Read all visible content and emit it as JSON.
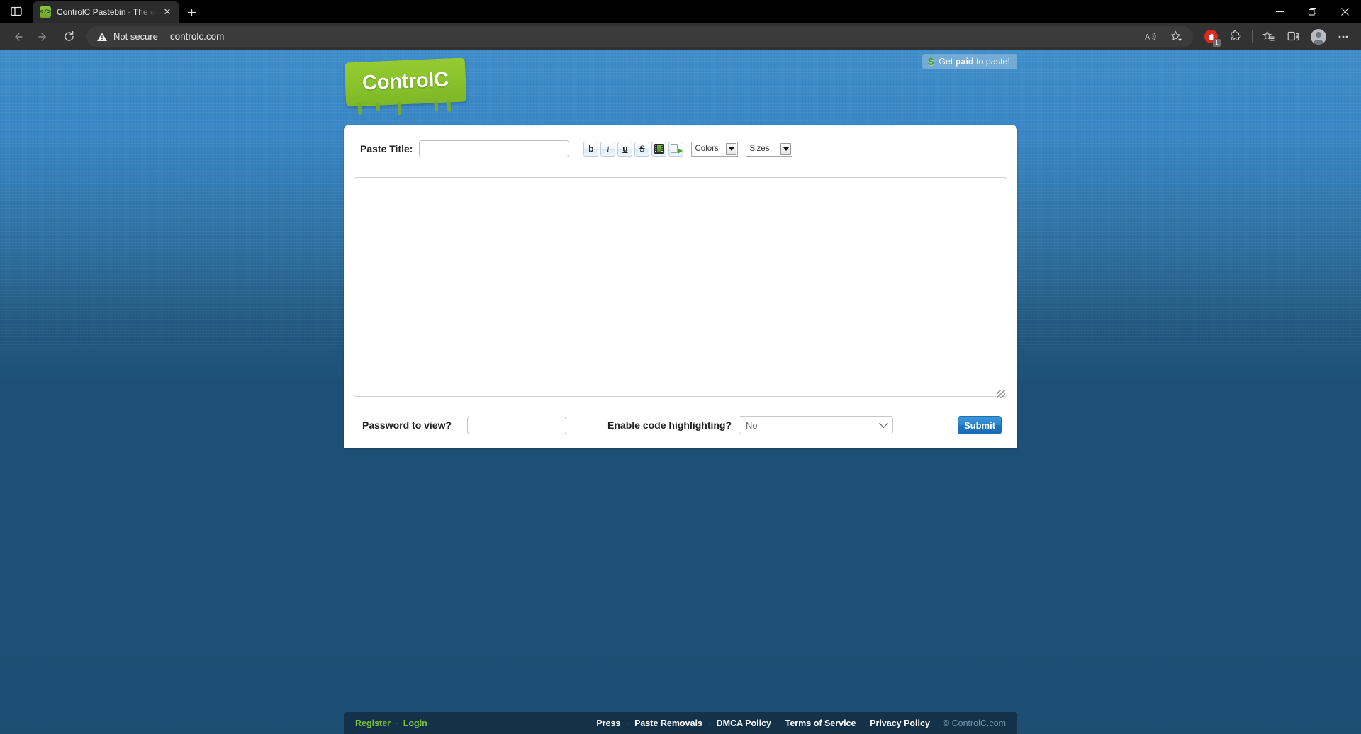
{
  "browser": {
    "tab_search_icon": "tab-search-icon",
    "tab": {
      "title": "ControlC Pastebin - The easiest w",
      "favicon": "code-brackets-favicon",
      "close_label": "✕"
    },
    "new_tab_label": "＋",
    "window_controls": {
      "minimize": "─",
      "restore": "❐",
      "close": "✕"
    },
    "nav": {
      "back": "←",
      "forward": "→",
      "refresh": "↻"
    },
    "omnibox": {
      "security_text": "Not secure",
      "url": "controlc.com"
    },
    "toolbar_right": {
      "read_aloud": "A",
      "add_favorite": "add-favorite-icon",
      "extension_badge_count": "1",
      "extensions": "puzzle-icon",
      "collections": "collections-icon",
      "split_screen": "split-screen-icon",
      "profile": "profile-avatar",
      "settings": "…"
    }
  },
  "site": {
    "logo_text": "ControlC",
    "promo": {
      "icon": "$",
      "prefix": "Get ",
      "bold": "paid",
      "suffix": " to paste!"
    },
    "form": {
      "title_label": "Paste Title:",
      "title_value": "",
      "title_placeholder": "",
      "bbcode_buttons": [
        {
          "name": "bold-button",
          "glyph": "b"
        },
        {
          "name": "italic-button",
          "glyph": "i"
        },
        {
          "name": "underline-button",
          "glyph": "u"
        },
        {
          "name": "strikethrough-button",
          "glyph": "S"
        },
        {
          "name": "image-button",
          "glyph": ""
        },
        {
          "name": "link-button",
          "glyph": ""
        }
      ],
      "colors_label": "Colors",
      "sizes_label": "Sizes",
      "paste_value": "",
      "paste_placeholder": "",
      "password_label": "Password to view?",
      "password_value": "",
      "highlight_label": "Enable code highlighting?",
      "highlight_value": "No",
      "submit_label": "Submit"
    },
    "footer": {
      "left_links": [
        "Register",
        "Login"
      ],
      "right_links": [
        "Press",
        "Paste Removals",
        "DMCA Policy",
        "Terms of Service",
        "Privacy Policy"
      ],
      "separator": "·",
      "copyright": "© ControlC.com"
    }
  },
  "colors": {
    "brand_green": "#8bc42c",
    "page_blue_top": "#3f8ecb",
    "page_blue_bottom": "#1d4e72",
    "footer_navy": "#133249",
    "submit_blue": "#2b83c9",
    "link_green": "#7ec13b"
  }
}
